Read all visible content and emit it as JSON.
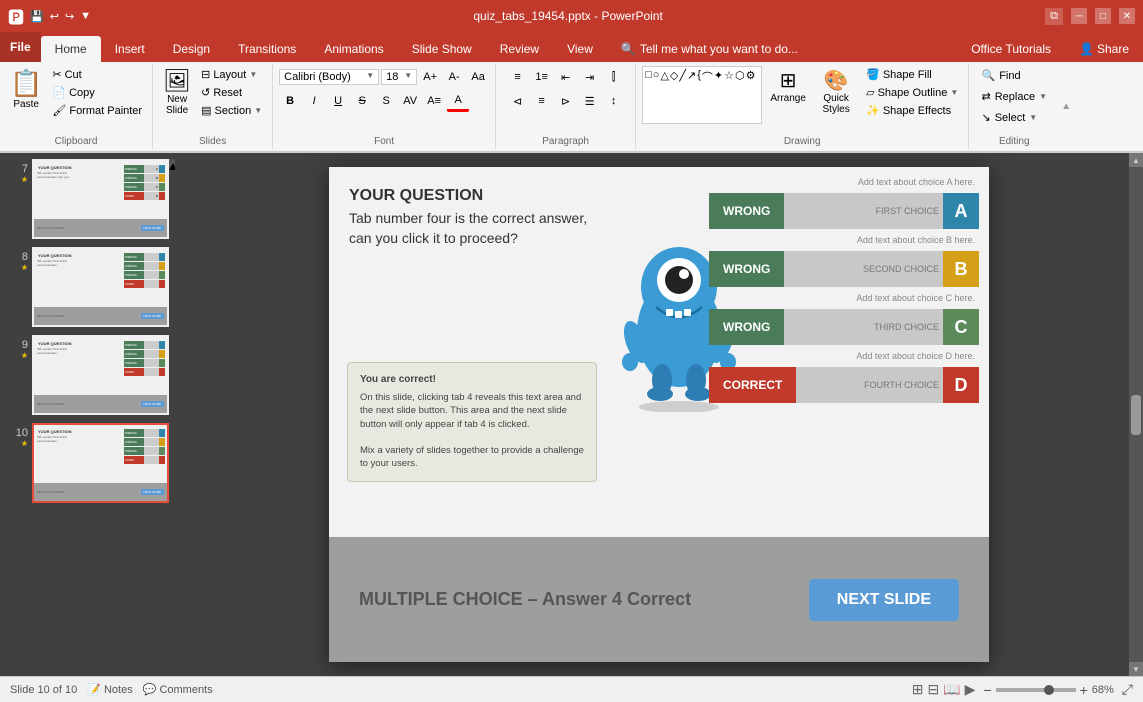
{
  "titlebar": {
    "filename": "quiz_tabs_19454.pptx - PowerPoint",
    "save_icon": "💾",
    "undo_icon": "↩",
    "redo_icon": "↪",
    "restore_icon": "⧉",
    "minimize_icon": "─",
    "maximize_icon": "□",
    "close_icon": "✕"
  },
  "tabs": [
    "File",
    "Home",
    "Insert",
    "Design",
    "Transitions",
    "Animations",
    "Slide Show",
    "Review",
    "View",
    "Tell me what you want to do..."
  ],
  "ribbon": {
    "clipboard_label": "Clipboard",
    "slides_label": "Slides",
    "font_label": "Font",
    "paragraph_label": "Paragraph",
    "drawing_label": "Drawing",
    "editing_label": "Editing",
    "paste_label": "Paste",
    "new_slide_label": "New\nSlide",
    "layout_label": "Layout",
    "reset_label": "Reset",
    "section_label": "Section",
    "shape_fill_label": "Shape Fill",
    "shape_outline_label": "Shape Outline",
    "shape_effects_label": "Shape Effects",
    "arrange_label": "Arrange",
    "quick_styles_label": "Quick\nStyles",
    "find_label": "Find",
    "replace_label": "Replace",
    "select_label": "Select"
  },
  "slide_panel": {
    "slides": [
      {
        "num": "7",
        "star": true
      },
      {
        "num": "8",
        "star": true
      },
      {
        "num": "9",
        "star": true
      },
      {
        "num": "10",
        "star": true,
        "active": true
      }
    ]
  },
  "slide": {
    "question_title": "YOUR QUESTION",
    "question_body": "Tab number four is the correct answer, can you click it to proceed?",
    "info_title": "You are correct!",
    "info_body": "On this slide, clicking tab 4 reveals this text area and the next slide button. This area and the next slide button will only appear if tab 4 is clicked.\n\nMix a variety of slides together to provide a challenge to your users.",
    "choices": [
      {
        "status": "WRONG",
        "label": "FIRST CHOICE",
        "letter": "A",
        "letter_class": "letter-a",
        "status_class": "choice-wrong",
        "hint": "Add text about choice A here."
      },
      {
        "status": "WRONG",
        "label": "SECOND CHOICE",
        "letter": "B",
        "letter_class": "letter-b",
        "status_class": "choice-wrong",
        "hint": "Add text about choice B here."
      },
      {
        "status": "WRONG",
        "label": "THIRD CHOICE",
        "letter": "C",
        "letter_class": "letter-c",
        "status_class": "choice-wrong",
        "hint": "Add text about choice C here."
      },
      {
        "status": "CORRECT",
        "label": "FOURTH CHOICE",
        "letter": "D",
        "letter_class": "letter-d",
        "status_class": "choice-correct",
        "hint": "Add text about choice D here."
      }
    ],
    "bottom_text": "MULTIPLE CHOICE – Answer 4 Correct",
    "next_slide": "NEXT SLIDE"
  },
  "statusbar": {
    "slide_info": "Slide 10 of 10",
    "notes_label": "Notes",
    "comments_label": "Comments",
    "zoom_level": "68%",
    "zoom_minus": "−",
    "zoom_plus": "+"
  },
  "help_text": "Office Tutorials",
  "share_text": "Share"
}
